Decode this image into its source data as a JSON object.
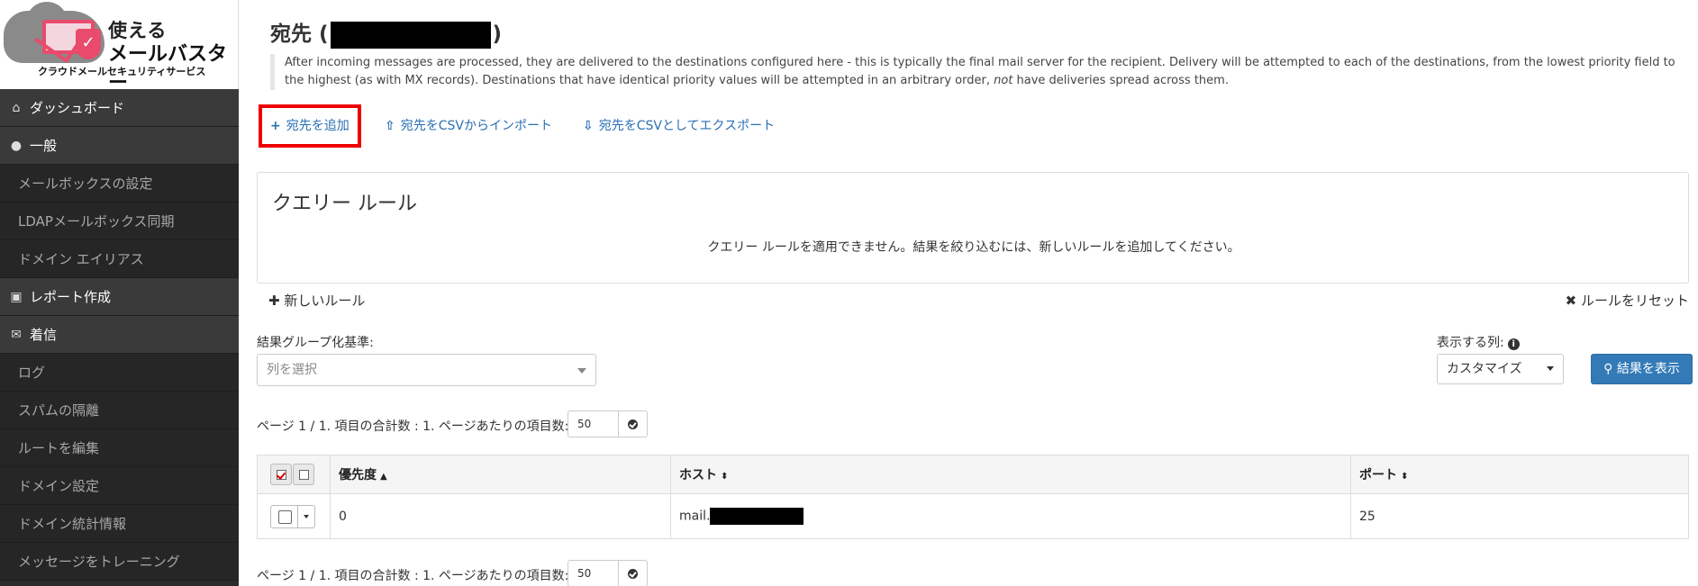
{
  "logo": {
    "line1": "使える",
    "line2": "メールバスター",
    "subtitle": "クラウドメールセキュリティサービス"
  },
  "sidebar": {
    "items": [
      {
        "label": "ダッシュボード",
        "type": "section",
        "icon": "home-icon"
      },
      {
        "label": "一般",
        "type": "section",
        "icon": "globe-icon"
      },
      {
        "label": "メールボックスの設定",
        "type": "sub"
      },
      {
        "label": "LDAPメールボックス同期",
        "type": "sub"
      },
      {
        "label": "ドメイン エイリアス",
        "type": "sub"
      },
      {
        "label": "レポート作成",
        "type": "section",
        "icon": "inbox-icon"
      },
      {
        "label": "着信",
        "type": "section",
        "icon": "envelope-icon"
      },
      {
        "label": "ログ",
        "type": "sub"
      },
      {
        "label": "スパムの隔離",
        "type": "sub"
      },
      {
        "label": "ルートを編集",
        "type": "sub"
      },
      {
        "label": "ドメイン設定",
        "type": "sub"
      },
      {
        "label": "ドメイン統計情報",
        "type": "sub"
      },
      {
        "label": "メッセージをトレーニング",
        "type": "sub"
      }
    ]
  },
  "page": {
    "title_prefix": "宛先 (",
    "title_suffix": ")",
    "description_part1": "After incoming messages are processed, they are delivered to the destinations configured here - this is typically the final mail server for the recipient. Delivery will be attempted to each of the destinations, from the lowest priority field to the highest (as with MX records). Destinations that have identical priority values will be attempted in an arbitrary order, ",
    "description_em": "not",
    "description_part2": " have deliveries spread across them."
  },
  "actions": {
    "add": "宛先を追加",
    "import": "宛先をCSVからインポート",
    "export": "宛先をCSVとしてエクスポート"
  },
  "query": {
    "title": "クエリー ルール",
    "message": "クエリー ルールを適用できません。結果を絞り込むには、新しいルールを追加してください。",
    "new_rule": "新しいルール",
    "reset_rule": "ルールをリセット"
  },
  "grouping": {
    "label": "結果グループ化基準:",
    "placeholder": "列を選択"
  },
  "columns": {
    "label": "表示する列:",
    "selected": "カスタマイズ",
    "show_button": "結果を表示"
  },
  "pager": {
    "text": "ページ 1 / 1. 項目の合計数 : 1. ページあたりの項目数:",
    "per_page": "50"
  },
  "table": {
    "headers": {
      "priority": "優先度",
      "host": "ホスト",
      "port": "ポート"
    },
    "rows": [
      {
        "priority": "0",
        "host_prefix": "mail.",
        "port": "25"
      }
    ]
  }
}
